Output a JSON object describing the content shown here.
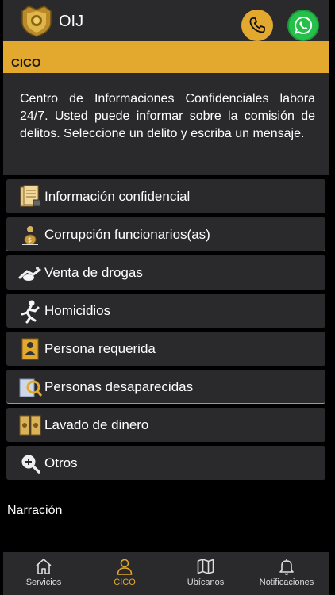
{
  "header": {
    "title": "OIJ",
    "colors": {
      "accent": "#e3a92e",
      "whatsapp": "#25c04a",
      "panel": "#2a2a2c"
    }
  },
  "section": {
    "title": "CICO"
  },
  "intro": {
    "text": "Centro de Informaciones Confidenciales labora 24/7. Usted puede informar sobre la comisión de delitos. Seleccione un delito y escriba un mensaje."
  },
  "menu": {
    "items": [
      {
        "label": "Información confidencial",
        "icon": "confidential-document-icon"
      },
      {
        "label": "Corrupción funcionarios(as)",
        "icon": "corruption-icon"
      },
      {
        "label": "Venta de drogas",
        "icon": "drugs-icon"
      },
      {
        "label": "Homicidios",
        "icon": "homicide-icon"
      },
      {
        "label": "Persona requerida",
        "icon": "wanted-person-icon"
      },
      {
        "label": "Personas desaparecidas",
        "icon": "missing-persons-icon"
      },
      {
        "label": "Lavado de dinero",
        "icon": "money-laundering-icon"
      },
      {
        "label": "Otros",
        "icon": "search-plus-icon"
      }
    ]
  },
  "narration": {
    "label": "Narración"
  },
  "tabbar": {
    "tabs": [
      {
        "label": "Servicios",
        "icon": "home-icon"
      },
      {
        "label": "CICO",
        "icon": "person-icon",
        "active": true
      },
      {
        "label": "Ubícanos",
        "icon": "map-icon"
      },
      {
        "label": "Notificaciones",
        "icon": "bell-icon"
      }
    ]
  }
}
